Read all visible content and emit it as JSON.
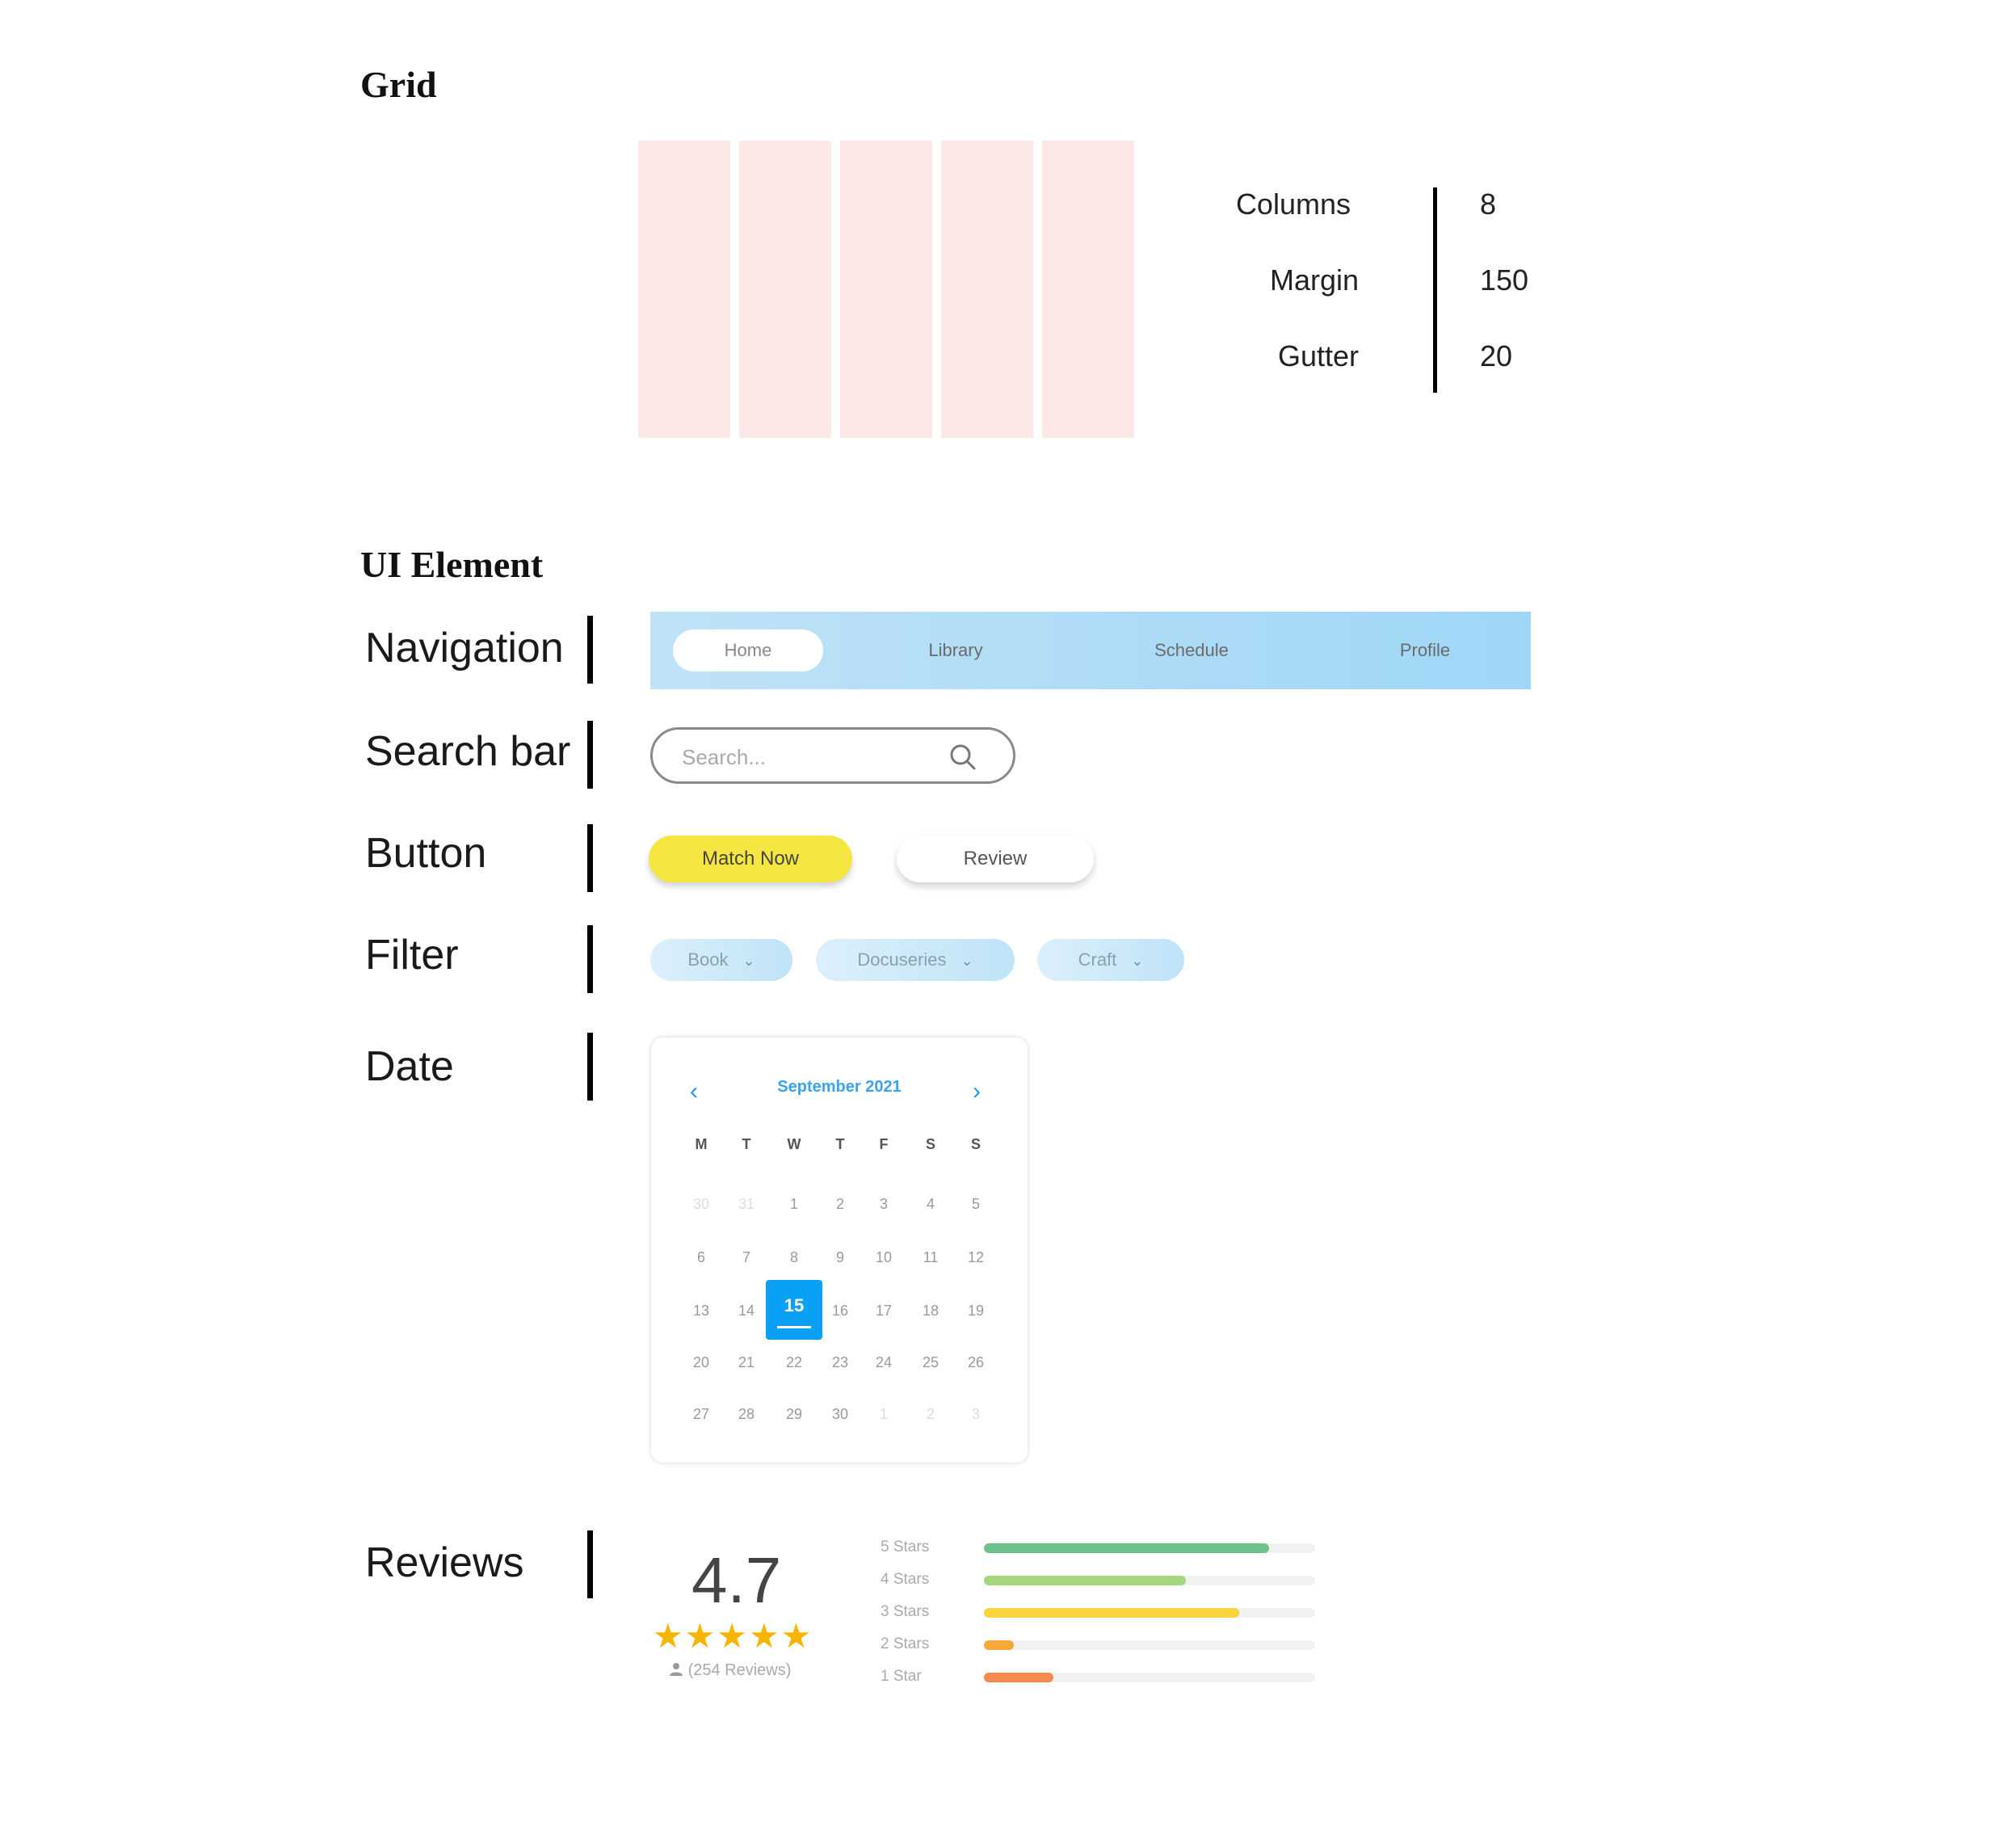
{
  "sections": {
    "grid_title": "Grid",
    "ui_title": "UI Element"
  },
  "grid": {
    "specs": [
      {
        "label": "Columns",
        "value": "8"
      },
      {
        "label": "Margin",
        "value": "150"
      },
      {
        "label": "Gutter",
        "value": "20"
      }
    ]
  },
  "rows": {
    "navigation": "Navigation",
    "search": "Search bar",
    "button": "Button",
    "filter": "Filter",
    "date": "Date",
    "reviews": "Reviews"
  },
  "navigation": {
    "items": [
      "Home",
      "Library",
      "Schedule",
      "Profile"
    ],
    "active": "Home"
  },
  "search": {
    "placeholder": "Search..."
  },
  "buttons": {
    "primary": "Match Now",
    "secondary": "Review"
  },
  "filters": [
    "Book",
    "Docuseries",
    "Craft"
  ],
  "calendar": {
    "month": "September 2021",
    "weekdays": [
      "M",
      "T",
      "W",
      "T",
      "F",
      "S",
      "S"
    ],
    "weeks": [
      [
        "30",
        "31",
        "1",
        "2",
        "3",
        "4",
        "5"
      ],
      [
        "6",
        "7",
        "8",
        "9",
        "10",
        "11",
        "12"
      ],
      [
        "13",
        "14",
        "15",
        "16",
        "17",
        "18",
        "19"
      ],
      [
        "20",
        "21",
        "22",
        "23",
        "24",
        "25",
        "26"
      ],
      [
        "27",
        "28",
        "29",
        "30",
        "1",
        "2",
        "3"
      ]
    ],
    "selected": "15"
  },
  "reviews": {
    "rating": "4.7",
    "stars": "★★★★★",
    "count": "(254 Reviews)",
    "breakdown": [
      {
        "label": "5 Stars",
        "fraction": 0.86,
        "color": "#6cc28a"
      },
      {
        "label": "4 Stars",
        "fraction": 0.61,
        "color": "#a5d67f"
      },
      {
        "label": "3 Stars",
        "fraction": 0.77,
        "color": "#f7d43c"
      },
      {
        "label": "2 Stars",
        "fraction": 0.09,
        "color": "#f5a93a"
      },
      {
        "label": "1 Star",
        "fraction": 0.21,
        "color": "#f28a52"
      }
    ]
  },
  "colors": {
    "grid_column": "#fde8e8",
    "nav_bg": "#9fd6f7",
    "primary_button": "#f5e642",
    "selected_day": "#0aa0f5",
    "star": "#f7b500"
  }
}
